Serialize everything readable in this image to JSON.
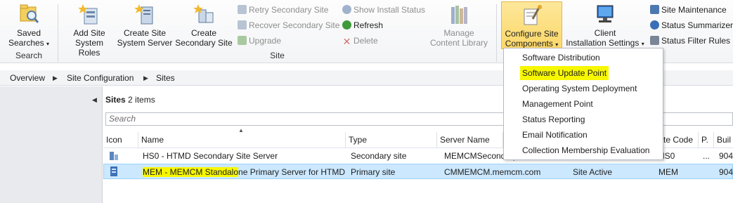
{
  "ribbon": {
    "search_group": {
      "label": "Search",
      "saved_searches_line1": "Saved",
      "saved_searches_line2": "Searches"
    },
    "site_group": {
      "label": "Site",
      "add_site_system_roles_line1": "Add Site",
      "add_site_system_roles_line2": "System Roles",
      "create_site_system_server_line1": "Create Site",
      "create_site_system_server_line2": "System Server",
      "create_secondary_site_line1": "Create",
      "create_secondary_site_line2": "Secondary Site",
      "retry_secondary_site": "Retry Secondary Site",
      "recover_secondary_site": "Recover Secondary Site",
      "upgrade": "Upgrade",
      "show_install_status": "Show Install Status",
      "refresh": "Refresh",
      "delete": "Delete",
      "manage_content_library_line1": "Manage",
      "manage_content_library_line2": "Content Library",
      "configure_site_components_line1": "Configure Site",
      "configure_site_components_line2": "Components",
      "client_installation_settings_line1": "Client",
      "client_installation_settings_line2": "Installation Settings",
      "site_maintenance": "Site Maintenance",
      "status_summarizers": "Status Summarizers",
      "status_filter_rules": "Status Filter Rules"
    }
  },
  "breadcrumb": [
    "Overview",
    "Site Configuration",
    "Sites"
  ],
  "list_header": {
    "title": "Sites",
    "count": "2 items",
    "search_placeholder": "Search"
  },
  "columns": [
    "Icon",
    "Name",
    "Type",
    "Server Name",
    "",
    "te Code",
    "P.",
    "Buil"
  ],
  "rows": [
    {
      "name": "HS0 - HTMD Secondary Site Server",
      "type": "Secondary site",
      "server": "MEMCMSecondary",
      "state": "",
      "code": "HS0",
      "p": "...",
      "build": "904"
    },
    {
      "name_highlighted": "MEM - MEMCM Standalo",
      "name_rest": "ne Primary Server for HTMD",
      "type": "Primary site",
      "server": "CMMEMCM.memcm.com",
      "state": "Site Active",
      "code": "MEM",
      "p": "",
      "build": "904"
    }
  ],
  "dropdown_menu": [
    "Software Distribution",
    "Software Update Point",
    "Operating System Deployment",
    "Management Point",
    "Status Reporting",
    "Email Notification",
    "Collection Membership Evaluation"
  ],
  "colors": {
    "highlight": "#f7f700",
    "selected_row": "#cce8ff",
    "active_button": "#fcd869"
  }
}
